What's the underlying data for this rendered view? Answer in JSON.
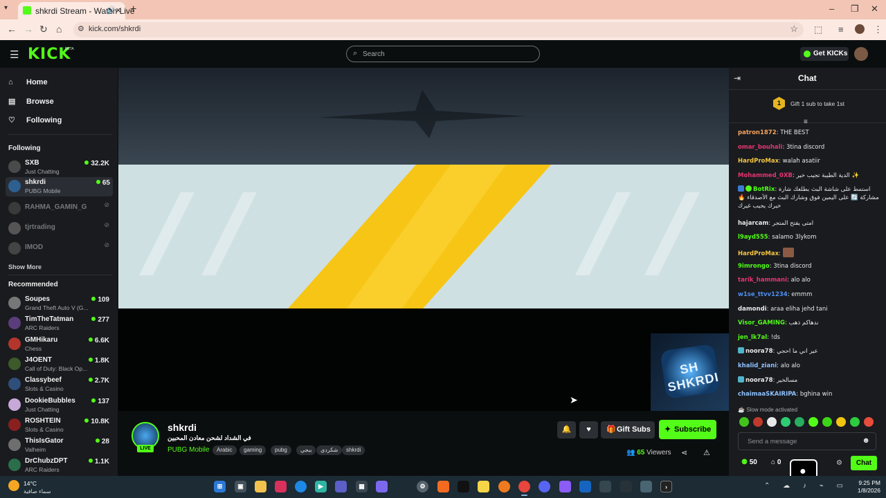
{
  "browser": {
    "tab_title": "shkrdi Stream - Watch Live",
    "url": "kick.com/shkrdi"
  },
  "header": {
    "logo": "KICK",
    "logo_badge": "BETA",
    "search_placeholder": "Search",
    "get_kicks": "Get KICKs"
  },
  "sidebar": {
    "nav": [
      {
        "label": "Home",
        "icon": "home-icon"
      },
      {
        "label": "Browse",
        "icon": "browse-icon"
      },
      {
        "label": "Following",
        "icon": "heart-icon"
      }
    ],
    "following_title": "Following",
    "following": [
      {
        "name": "SXB",
        "category": "Just Chatting",
        "viewers": "32.2K",
        "live": true
      },
      {
        "name": "shkrdi",
        "category": "PUBG Mobile",
        "viewers": "65",
        "live": true
      },
      {
        "name": "RAHMA_GAMIN_G",
        "category": "",
        "viewers": "",
        "live": false
      },
      {
        "name": "tjrtrading",
        "category": "",
        "viewers": "",
        "live": false
      },
      {
        "name": "IMOD",
        "category": "",
        "viewers": "",
        "live": false
      }
    ],
    "show_more": "Show More",
    "recommended_title": "Recommended",
    "recommended": [
      {
        "name": "Soupes",
        "category": "Grand Theft Auto V (G...",
        "viewers": "109"
      },
      {
        "name": "TimTheTatman",
        "category": "ARC Raiders",
        "viewers": "277"
      },
      {
        "name": "GMHikaru",
        "category": "Chess",
        "viewers": "6.6K"
      },
      {
        "name": "J4OENT",
        "category": "Call of Duty: Black Op...",
        "viewers": "1.8K"
      },
      {
        "name": "Classybeef",
        "category": "Slots & Casino",
        "viewers": "2.7K"
      },
      {
        "name": "DookieBubbles",
        "category": "Just Chatting",
        "viewers": "137"
      },
      {
        "name": "ROSHTEIN",
        "category": "Slots & Casino",
        "viewers": "10.8K"
      },
      {
        "name": "ThisIsGator",
        "category": "Valheim",
        "viewers": "28"
      },
      {
        "name": "DrChubzDPT",
        "category": "ARC Raiders",
        "viewers": "1.1K"
      }
    ]
  },
  "video": {
    "thumb_text": "SH SHKRDI"
  },
  "channel": {
    "name": "shkrdi",
    "live_label": "LIVE",
    "title": "في الشداد لشحن معادن المحبين",
    "category": "PUBG Mobile",
    "tags": [
      "Arabic",
      "gaming",
      "pubg",
      "ببجي",
      "شكردي",
      "shkrdi"
    ],
    "gift_subs": "Gift Subs",
    "subscribe": "Subscribe",
    "viewers_count": "65",
    "viewers_label": "Viewers"
  },
  "chat": {
    "title": "Chat",
    "gift_rank": "1",
    "gift_prompt": "Gift 1 sub to take 1st",
    "messages": [
      {
        "user": "patron1872",
        "color": "#f5a25d",
        "text": "THE BEST"
      },
      {
        "user": "omar_bouhali",
        "color": "#e5356f",
        "text": "3tina discord"
      },
      {
        "user": "HardProMax",
        "color": "#f5c542",
        "text": "walah asatiir"
      },
      {
        "user": "Mohammed_0XB",
        "color": "#e5356f",
        "text": "الدية الطيبة تجيب خير ✨"
      },
      {
        "user": "BotRix",
        "color": "#53fc18",
        "text": "استمط على شاشة البث بطلعك شارة مشاركة 🔄 على اليمين فوق وشارك البث مع الأصدقاء 🔥 خيرك يجيب غيرك"
      },
      {
        "user": "hajarcam",
        "color": "#e8e8e8",
        "text": "امتى يفتح المتجر"
      },
      {
        "user": "l9ayd555",
        "color": "#53fc18",
        "text": "salamo 3lykom"
      },
      {
        "user": "HardProMax",
        "color": "#f5c542",
        "text": ""
      },
      {
        "user": "9imrongo",
        "color": "#53fc18",
        "text": "3tina discord"
      },
      {
        "user": "tarik_hammani",
        "color": "#e5356f",
        "text": "alo alo"
      },
      {
        "user": "w1se_ttvv1234",
        "color": "#4d8ff0",
        "text": "emmm"
      },
      {
        "user": "damondi",
        "color": "#e8e8e8",
        "text": "araa eliha jehd tani"
      },
      {
        "user": "Visor_GAMING",
        "color": "#53fc18",
        "text": "ندهاكم ذهب"
      },
      {
        "user": "jen_lk7al",
        "color": "#53fc18",
        "text": "!ds"
      },
      {
        "user": "noora78",
        "color": "#e8e8e8",
        "text": "عير اني ما احجي"
      },
      {
        "user": "khalid_ziani",
        "color": "#8ec0ff",
        "text": "alo alo"
      },
      {
        "user": "noora78",
        "color": "#e8e8e8",
        "text": "مسالخير"
      },
      {
        "user": "chaimaaSKAIRIPA",
        "color": "#8ec0ff",
        "text": "bghina win"
      }
    ],
    "slow_mode": "Slow mode activated",
    "input_placeholder": "Send a message",
    "kicks_balance": "50",
    "gifts_count": "0",
    "send_label": "Chat"
  },
  "taskbar": {
    "temperature": "14°C",
    "weather_desc": "سماء صافية",
    "time": "9:25 PM",
    "date": "1/8/2026"
  },
  "colors": {
    "brand": "#53fc18",
    "background": "#0b0e0f",
    "panel": "#191b1f"
  }
}
